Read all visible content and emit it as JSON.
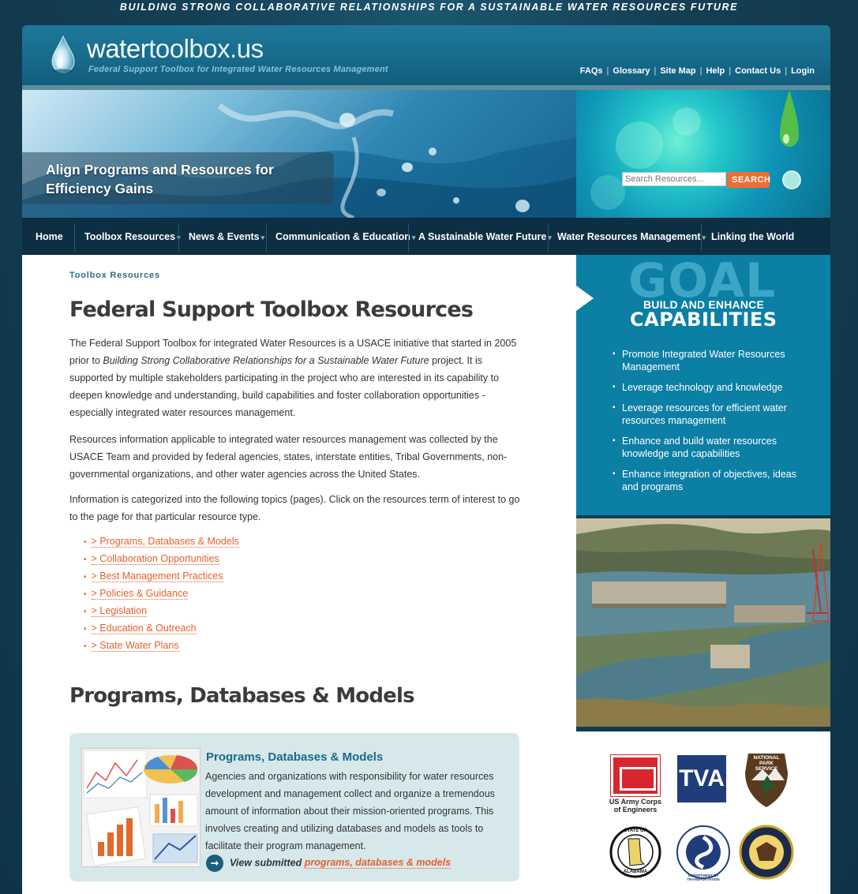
{
  "tagline": "BUILDING STRONG COLLABORATIVE RELATIONSHIPS FOR A SUSTAINABLE WATER RESOURCES FUTURE",
  "header": {
    "logo_main": "water",
    "logo_rest": "toolbox.us",
    "logo_sub": "Federal Support Toolbox for Integrated Water Resources Management",
    "util_links": [
      "FAQs",
      "Glossary",
      "Site Map",
      "Help",
      "Contact Us",
      "Login"
    ]
  },
  "banner": {
    "caption_line1": "Align Programs and Resources for",
    "caption_line2": "Efficiency Gains"
  },
  "search": {
    "placeholder": "Search Resources...",
    "button": "SEARCH"
  },
  "nav": {
    "items": [
      {
        "label": "Home",
        "has_dropdown": false
      },
      {
        "label": "Toolbox Resources",
        "has_dropdown": true
      },
      {
        "label": "News & Events",
        "has_dropdown": true
      },
      {
        "label": "Communication & Education",
        "has_dropdown": true
      },
      {
        "label": "A Sustainable Water Future",
        "has_dropdown": true
      },
      {
        "label": "Water Resources Management",
        "has_dropdown": true
      },
      {
        "label": "Linking the World",
        "has_dropdown": false
      }
    ]
  },
  "content": {
    "breadcrumb": "Toolbox Resources",
    "title": "Federal Support Toolbox Resources",
    "para1_a": "The Federal Support Toolbox for integrated Water Resources is a USACE initiative that started in 2005 prior to ",
    "para1_i": "Building Strong Collaborative Relationships for a Sustainable Water Future",
    "para1_b": " project. It is supported by multiple stakeholders participating in the project who are interested in its capability to deepen knowledge and understanding, build capabilities and foster collaboration opportunities - especially integrated water resources management.",
    "para2": "Resources information applicable to integrated water resources management was collected by the USACE Team and provided by federal agencies, states, interstate entities, Tribal Governments, non-governmental organizations, and other water agencies across the United States.",
    "para3": "Information is categorized into the following topics (pages). Click on the resources term of interest to go to the page for that particular resource type.",
    "resources": [
      "> Programs, Databases & Models",
      "> Collaboration Opportunities",
      "> Best Management Practices",
      "> Policies & Guidance",
      "> Legislation",
      "> Education & Outreach",
      "> State Water Plans"
    ],
    "section_title": "Programs, Databases & Models",
    "card": {
      "title": "Programs, Databases & Models",
      "text": "Agencies and organizations with responsibility for water resources development and management collect and organize a tremendous amount of information about their mission-oriented programs. This involves creating and utilizing databases and models as tools to facilitate their program management.",
      "cta_prefix": "View submitted ",
      "cta_link": "programs, databases & models"
    }
  },
  "goal": {
    "big": "GOAL",
    "sub1": "BUILD AND ENHANCE",
    "sub2": "CAPABILITIES",
    "items": [
      "Promote Integrated Water Resources Management",
      "Leverage technology and knowledge",
      "Leverage resources for efficient water resources management",
      "Enhance and build water resources knowledge and capabilities",
      "Enhance integration of objectives, ideas and programs"
    ]
  },
  "logos": {
    "usace_line1": "US Army Corps",
    "usace_line2": "of Engineers",
    "tva": "TVA",
    "nps_line1": "NATIONAL",
    "nps_line2": "PARK",
    "nps_line3": "SERVICE",
    "alabama_top": "STATE OF",
    "alabama_bottom": "ALABAMA",
    "dot": "DEPARTMENT OF TRANSPORTATION"
  },
  "colors": {
    "accent": "#e8602a",
    "nav_bg": "#0d2f43",
    "goal_bg": "#0c7fa5",
    "header_bg": "#176b8c"
  }
}
